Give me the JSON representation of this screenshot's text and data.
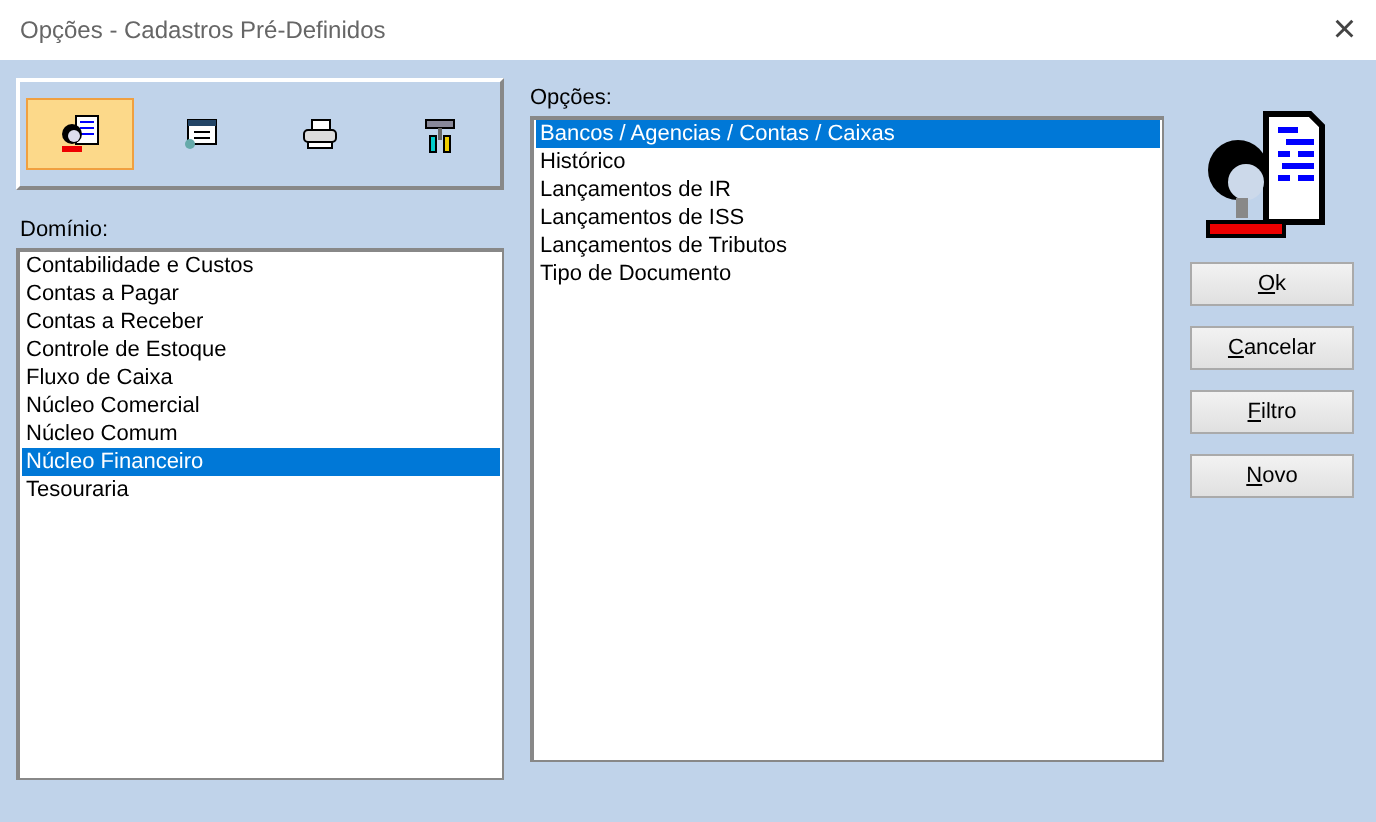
{
  "window": {
    "title": "Opções - Cadastros Pré-Definidos",
    "close": "×"
  },
  "toolbar": [
    {
      "kind": "person",
      "selected": true
    },
    {
      "kind": "form",
      "selected": false
    },
    {
      "kind": "printer",
      "selected": false
    },
    {
      "kind": "tools",
      "selected": false
    }
  ],
  "domain": {
    "label": "Domínio:",
    "items": [
      {
        "text": "Contabilidade e Custos",
        "selected": false
      },
      {
        "text": "Contas a Pagar",
        "selected": false
      },
      {
        "text": "Contas a Receber",
        "selected": false
      },
      {
        "text": "Controle de Estoque",
        "selected": false
      },
      {
        "text": "Fluxo de Caixa",
        "selected": false
      },
      {
        "text": "Núcleo Comercial",
        "selected": false
      },
      {
        "text": "Núcleo Comum",
        "selected": false
      },
      {
        "text": "Núcleo Financeiro",
        "selected": true
      },
      {
        "text": "Tesouraria",
        "selected": false
      }
    ]
  },
  "options": {
    "label": "Opções:",
    "items": [
      {
        "text": "Bancos / Agencias / Contas / Caixas",
        "selected": true
      },
      {
        "text": "Histórico",
        "selected": false
      },
      {
        "text": "Lançamentos de IR",
        "selected": false
      },
      {
        "text": "Lançamentos de ISS",
        "selected": false
      },
      {
        "text": "Lançamentos de Tributos",
        "selected": false
      },
      {
        "text": "Tipo de Documento",
        "selected": false
      }
    ]
  },
  "buttons": [
    {
      "key": "O",
      "rest": "k"
    },
    {
      "key": "C",
      "rest": "ancelar"
    },
    {
      "key": "F",
      "rest": "iltro"
    },
    {
      "key": "N",
      "rest": "ovo"
    }
  ]
}
